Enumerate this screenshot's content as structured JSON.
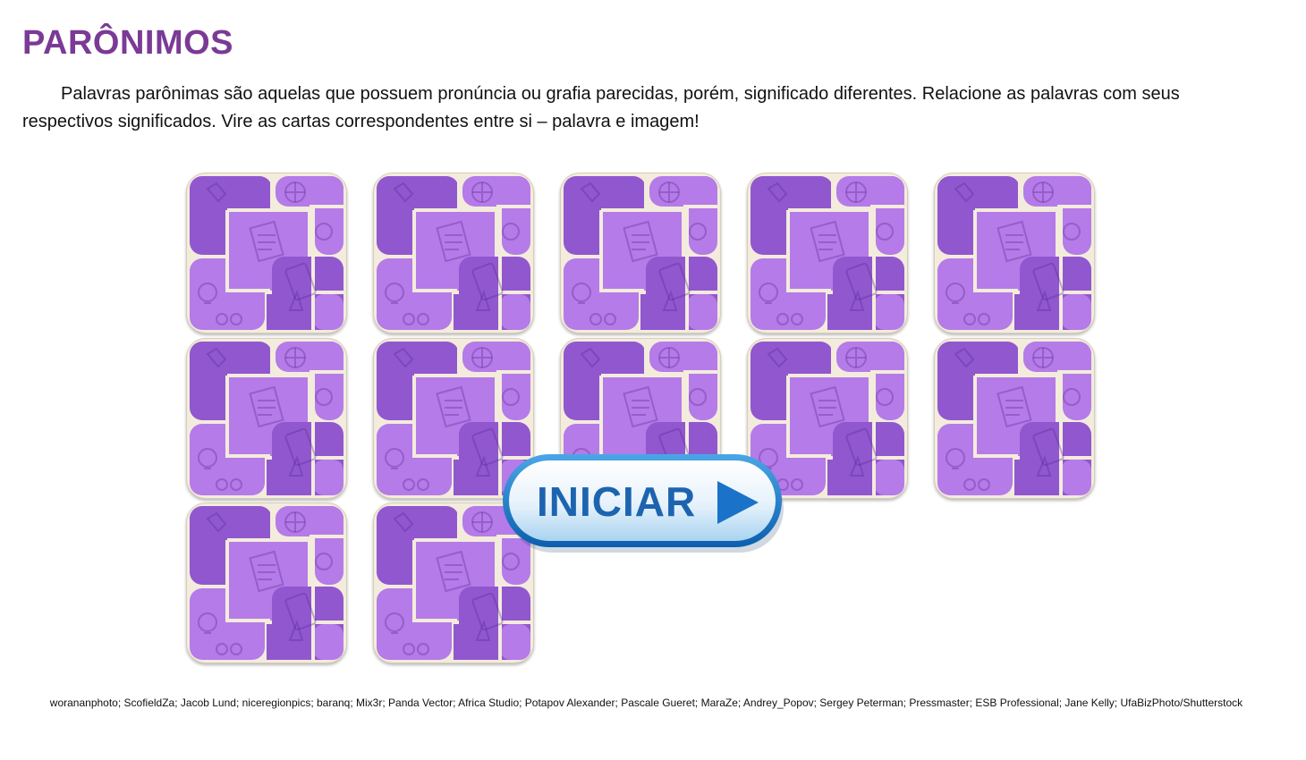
{
  "page": {
    "title": "PARÔNIMOS",
    "instructions": "Palavras parônimas são aquelas que possuem pronúncia ou grafia parecidas, porém, significado diferentes. Relacione as palavras com seus respectivos significados. Vire as cartas correspondentes entre si – palavra e imagem!",
    "credits": "worananphoto; ScofieldZa; Jacob Lund; niceregionpics; baranq; Mix3r; Panda Vector; Africa Studio; Potapov Alexander; Pascale Gueret; MaraZe; Andrey_Popov; Sergey Peterman; Pressmaster; ESB Professional; Jane Kelly; UfaBizPhoto/Shutterstock"
  },
  "game": {
    "card_count": 12,
    "cards_face_down": true,
    "start_button_label": "INICIAR",
    "colors": {
      "title": "#7b3a96",
      "card_light": "#b57be8",
      "card_dark": "#9157cf",
      "card_border": "#f3ecdc",
      "button_text": "#1d64b0",
      "button_arrow": "#1a73c8"
    }
  }
}
